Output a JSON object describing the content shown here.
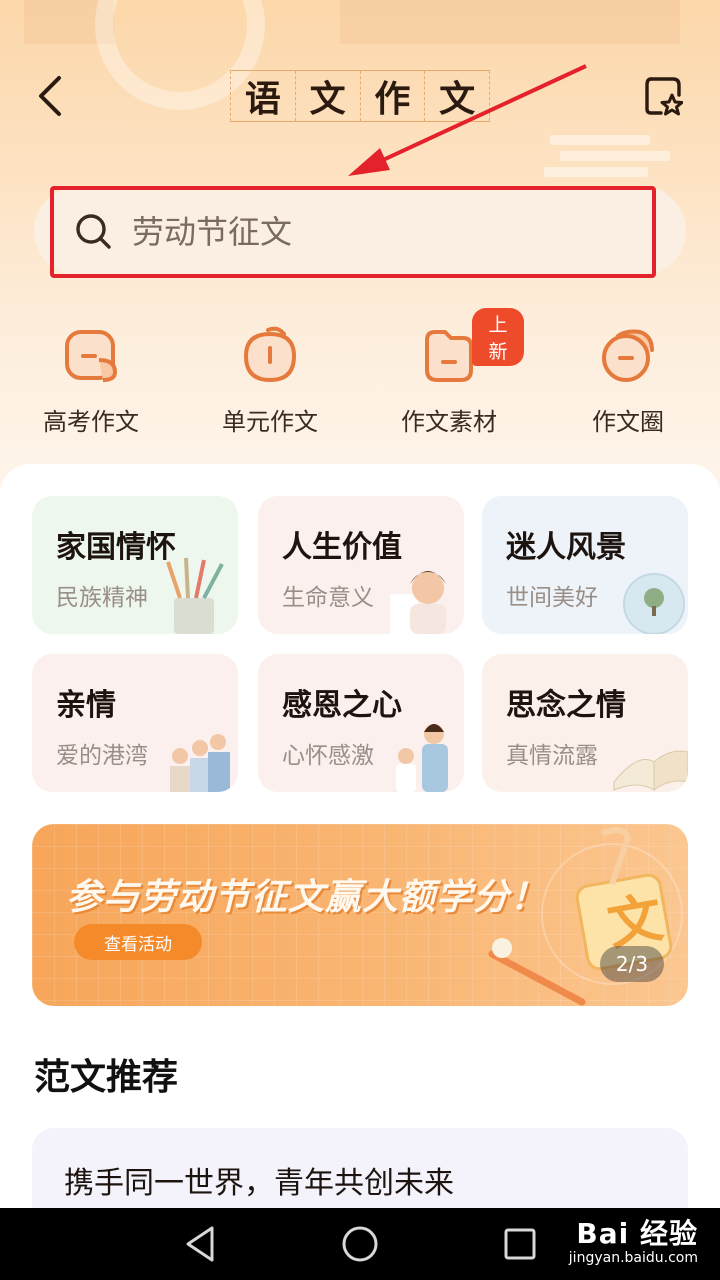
{
  "header": {
    "title_chars": [
      "语",
      "文",
      "作",
      "文"
    ]
  },
  "search": {
    "placeholder": "劳动节征文"
  },
  "quick_nav": [
    {
      "label": "高考作文",
      "icon": "gaokao-icon"
    },
    {
      "label": "单元作文",
      "icon": "unit-icon"
    },
    {
      "label": "作文素材",
      "icon": "material-icon",
      "badge": "上新"
    },
    {
      "label": "作文圈",
      "icon": "circle-icon"
    }
  ],
  "categories": [
    {
      "title": "家国情怀",
      "subtitle": "民族精神",
      "bg": "#eef7ee"
    },
    {
      "title": "人生价值",
      "subtitle": "生命意义",
      "bg": "#fbf0ee"
    },
    {
      "title": "迷人风景",
      "subtitle": "世间美好",
      "bg": "#edf3f9"
    },
    {
      "title": "亲情",
      "subtitle": "爱的港湾",
      "bg": "#fbf0ee"
    },
    {
      "title": "感恩之心",
      "subtitle": "心怀感激",
      "bg": "#fbf0ee"
    },
    {
      "title": "思念之情",
      "subtitle": "真情流露",
      "bg": "#fbf1ea"
    }
  ],
  "banner": {
    "title": "参与劳动节征文赢大额学分！",
    "button": "查看活动",
    "counter": "2/3"
  },
  "section": {
    "title": "范文推荐"
  },
  "articles": [
    {
      "title": "携手同一世界，青年共创未来"
    }
  ],
  "watermark": {
    "main": "Bai 经验",
    "sub": "jingyan.baidu.com"
  },
  "colors": {
    "accent": "#e3222b",
    "icon_orange": "#e57a3c",
    "badge": "#ee4b2b"
  }
}
